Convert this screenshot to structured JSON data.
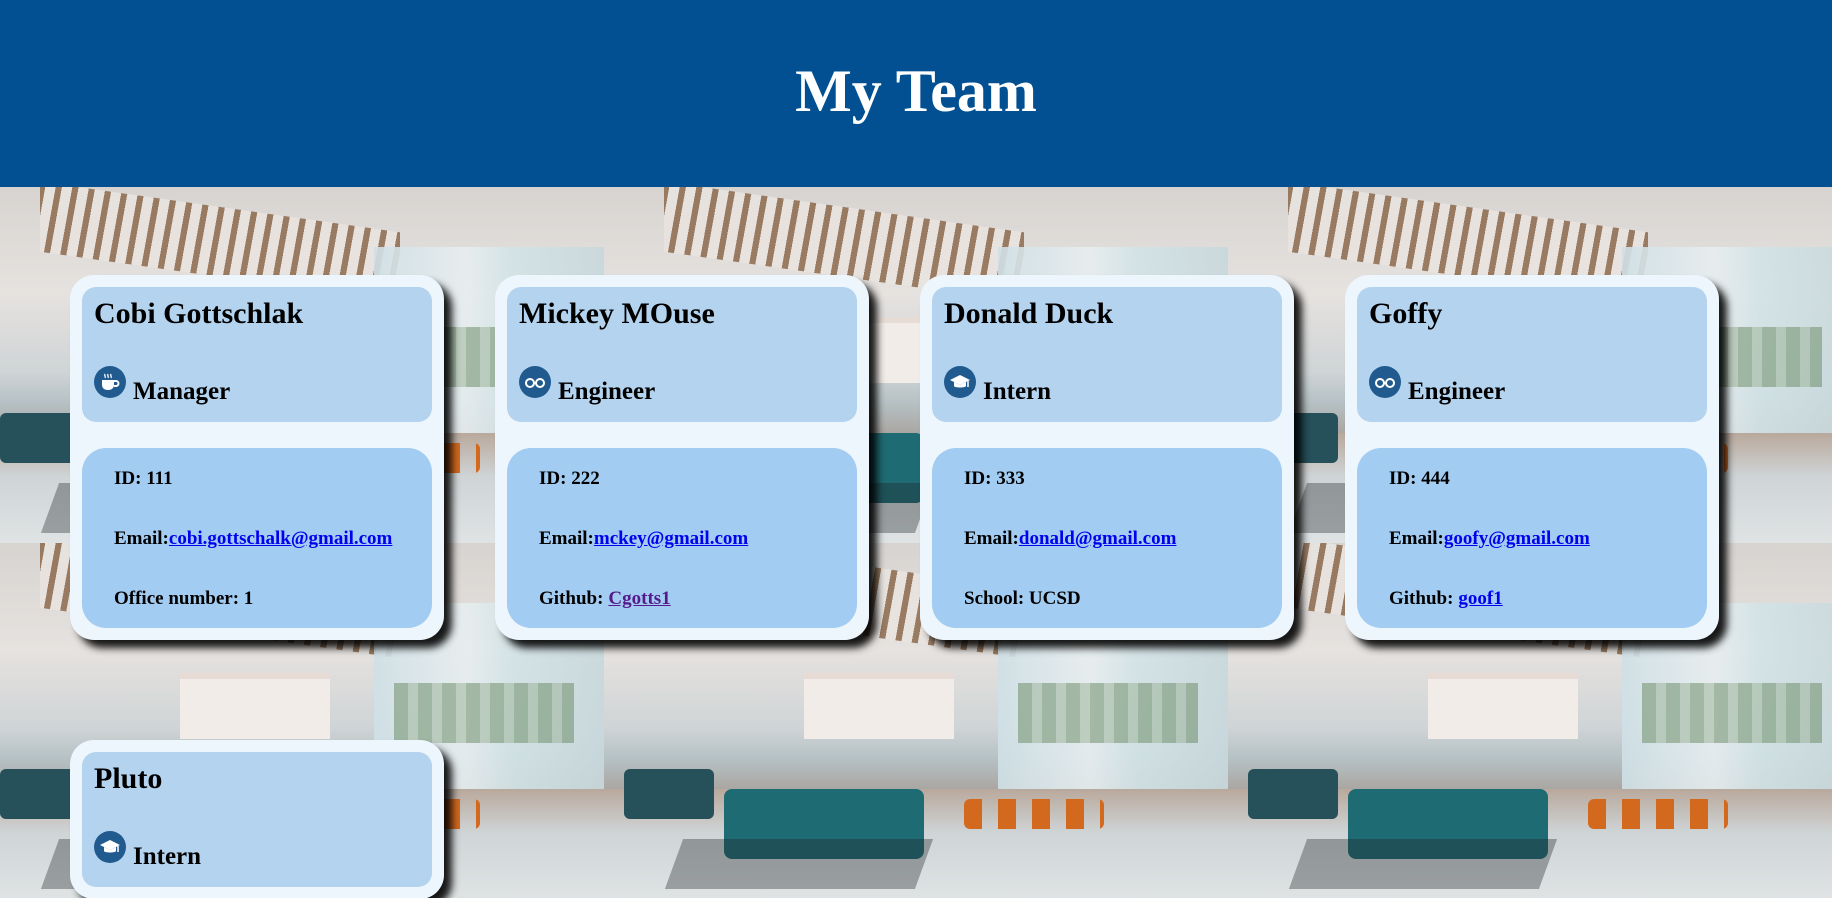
{
  "header": {
    "title": "My Team"
  },
  "team": [
    {
      "name": "Cobi Gottschlak",
      "role": "Manager",
      "role_icon": "coffee-icon",
      "id_text": "ID: 111",
      "email_label": "Email:",
      "email": "cobi.gottschalk@gmail.com",
      "extra_label": "Office number: 1",
      "extra_link": ""
    },
    {
      "name": "Mickey MOuse",
      "role": "Engineer",
      "role_icon": "glasses-icon",
      "id_text": "ID: 222",
      "email_label": "Email:",
      "email": "mckey@gmail.com",
      "extra_label": "Github:",
      "extra_link": "Cgotts1"
    },
    {
      "name": "Donald Duck",
      "role": "Intern",
      "role_icon": "graduation-cap-icon",
      "id_text": "ID: 333",
      "email_label": "Email:",
      "email": "donald@gmail.com",
      "extra_label": "School: UCSD",
      "extra_link": ""
    },
    {
      "name": "Goffy",
      "role": "Engineer",
      "role_icon": "glasses-icon",
      "id_text": "ID: 444",
      "email_label": "Email:",
      "email": "goofy@gmail.com",
      "extra_label": "Github:",
      "extra_link": "goof1"
    },
    {
      "name": "Pluto",
      "role": "Intern",
      "role_icon": "graduation-cap-icon"
    }
  ],
  "colors": {
    "header_bg": "#025092",
    "card_bg": "#eef6fd",
    "card_head_bg": "#b4d3ef",
    "card_body_bg": "#a2ccf2",
    "icon_bg": "#205a8e"
  }
}
